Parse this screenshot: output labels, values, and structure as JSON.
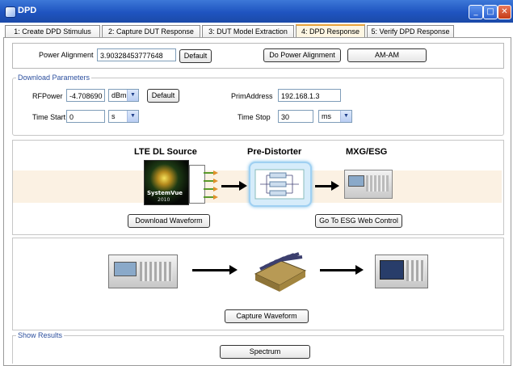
{
  "window": {
    "title": "DPD",
    "controls": [
      "minimize",
      "maximize",
      "close"
    ]
  },
  "tabs": [
    {
      "label": "1: Create DPD Stimulus"
    },
    {
      "label": "2: Capture DUT Response"
    },
    {
      "label": "3: DUT Model Extraction"
    },
    {
      "label": "4: DPD Response",
      "active": true
    },
    {
      "label": "5: Verify DPD Response"
    }
  ],
  "power_alignment": {
    "label": "Power Alignment",
    "value": "3.90328453777648",
    "default_button": "Default",
    "do_button": "Do Power Alignment",
    "amam_button": "AM-AM"
  },
  "download_parameters": {
    "group_label": "Download Parameters",
    "rfpower_label": "RFPower",
    "rfpower_value": "-4.708690",
    "rfpower_unit": "dBm",
    "default_button": "Default",
    "prim_address_label": "PrimAddress",
    "prim_address_value": "192.168.1.3",
    "time_start_label": "Time Start",
    "time_start_value": "0",
    "time_start_unit": "s",
    "time_stop_label": "Time Stop",
    "time_stop_value": "30",
    "time_stop_unit": "ms"
  },
  "diagram": {
    "source_title": "LTE DL Source",
    "predistorter_title": "Pre-Distorter",
    "mxg_title": "MXG/ESG",
    "systemvue_text": "SystemVue",
    "systemvue_year": "2010",
    "download_button": "Download Waveform",
    "esg_button": "Go To ESG Web Control"
  },
  "capture": {
    "button": "Capture Waveform"
  },
  "results": {
    "group_label": "Show Results",
    "spectrum_button": "Spectrum"
  },
  "colors": {
    "title_bar": "#1f54c0",
    "active_tab_accent": "#e8a33a",
    "band": "#fbf1e3",
    "group_label": "#2c4f9e"
  }
}
